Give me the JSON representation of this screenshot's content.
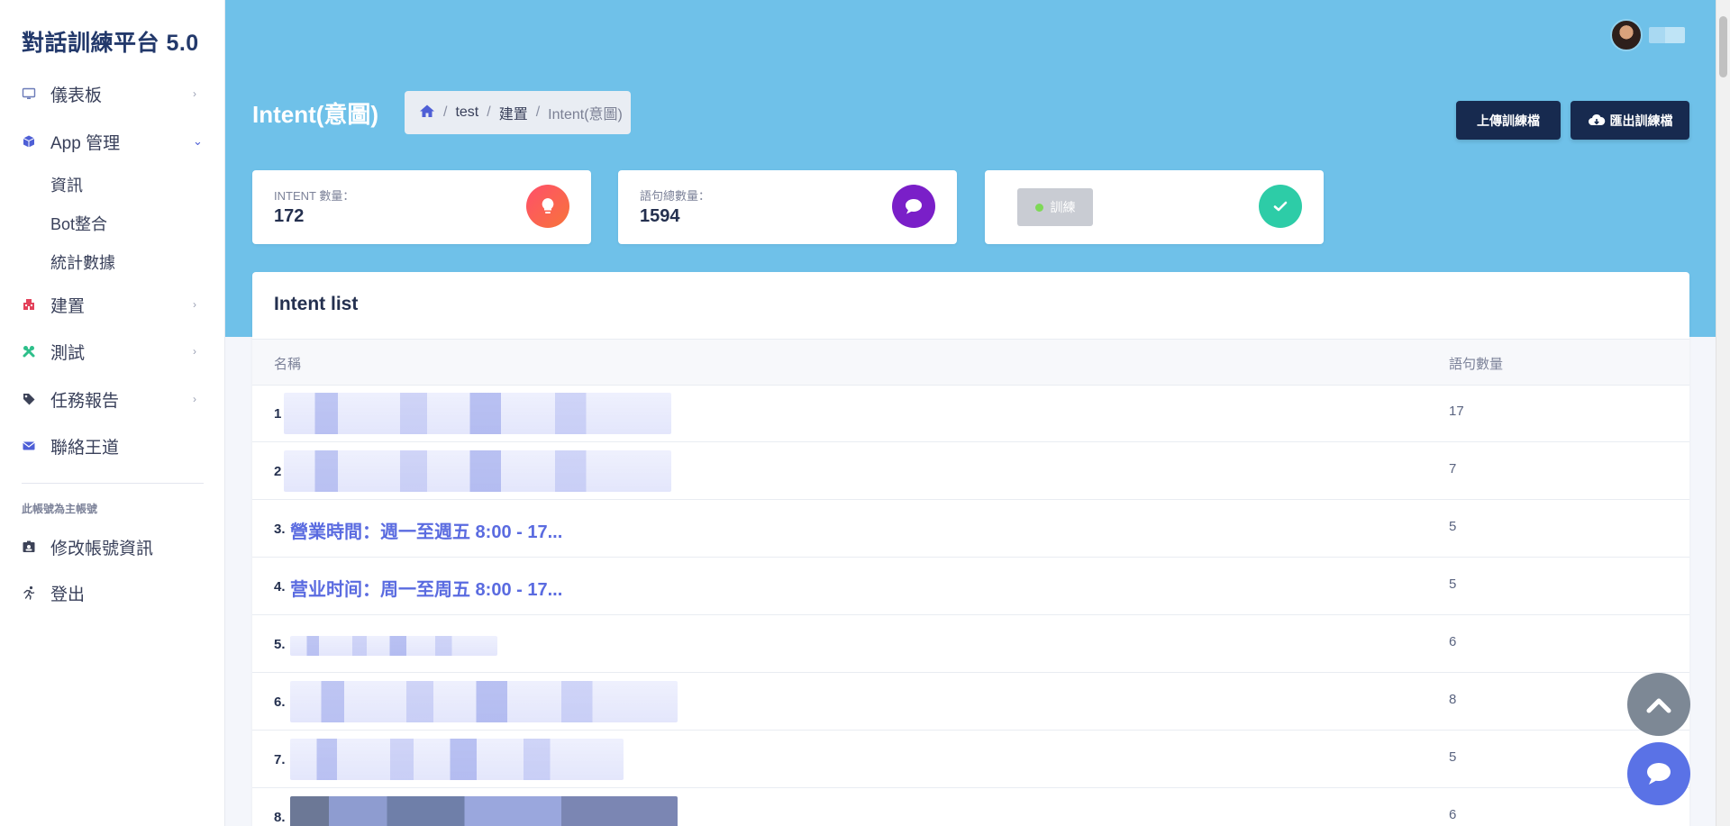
{
  "app": {
    "title": "對話訓練平台 5.0"
  },
  "sidebar": {
    "items": [
      {
        "label": "儀表板",
        "icon": "monitor-icon",
        "expanded": false
      },
      {
        "label": "App 管理",
        "icon": "cube-icon",
        "expanded": true,
        "children": [
          {
            "label": "資訊"
          },
          {
            "label": "Bot整合"
          },
          {
            "label": "統計數據"
          }
        ]
      },
      {
        "label": "建置",
        "icon": "building-icon",
        "expanded": false
      },
      {
        "label": "測試",
        "icon": "tools-icon",
        "expanded": false
      },
      {
        "label": "任務報告",
        "icon": "tag-icon",
        "expanded": false
      },
      {
        "label": "聯絡王道",
        "icon": "envelope-icon"
      }
    ],
    "section_label": "此帳號為主帳號",
    "account_items": [
      {
        "label": "修改帳號資訊",
        "icon": "id-card-icon"
      },
      {
        "label": "登出",
        "icon": "running-icon"
      }
    ]
  },
  "header": {
    "page_title": "Intent(意圖)",
    "breadcrumb": [
      "test",
      "建置",
      "Intent(意圖)"
    ],
    "upload_label": "上傳訓練檔",
    "export_label": "匯出訓練檔"
  },
  "stats": {
    "intent_count_label": "INTENT 數量：",
    "intent_count": "172",
    "sentence_count_label": "語句總數量：",
    "sentence_count": "1594",
    "train_label": "訓練"
  },
  "intent_list": {
    "title": "Intent list",
    "columns": {
      "name": "名稱",
      "count": "語句數量"
    },
    "rows": [
      {
        "num": "1",
        "name": "",
        "count": "17"
      },
      {
        "num": "2",
        "name": "",
        "count": "7"
      },
      {
        "num": "3.",
        "name": "營業時間：週一至週五 8:00 - 17...",
        "count": "5"
      },
      {
        "num": "4.",
        "name": "营业时间：周一至周五 8:00 - 17...",
        "count": "5"
      },
      {
        "num": "5.",
        "name": "",
        "count": "6"
      },
      {
        "num": "6.",
        "name": "",
        "count": "8"
      },
      {
        "num": "7.",
        "name": "",
        "count": "5"
      },
      {
        "num": "8.",
        "name": "",
        "count": "6"
      }
    ]
  },
  "colors": {
    "header_band": "#6fc1e9",
    "dark_button": "#172a4f",
    "intent_icon_gradient": [
      "#ff5e62",
      "#f7743b"
    ],
    "sentence_icon": "#7a1fc8",
    "train_icon": "#2dcca7",
    "link": "#5a6be0",
    "scroll_top_fab": "#7d8895",
    "chat_fab": "#5a72e6"
  }
}
